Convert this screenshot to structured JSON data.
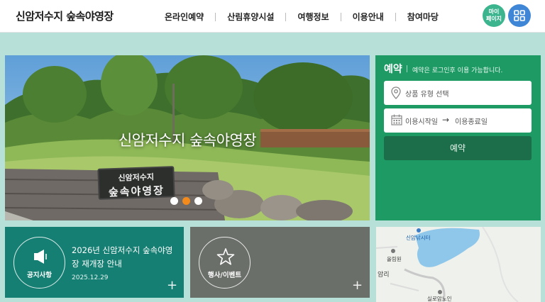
{
  "header": {
    "site_title": "신암저수지 숲속야영장",
    "nav": [
      "온라인예약",
      "산림휴양시설",
      "여행정보",
      "이용안내",
      "참여마당"
    ],
    "mypage_line1": "마이",
    "mypage_line2": "페이지"
  },
  "hero": {
    "title": "신암저수지 숲속야영장",
    "sign_line1": "신암저수지",
    "sign_line2": "숲속야영장",
    "slide_count": 3,
    "active_slide": 2
  },
  "reservation": {
    "title": "예약",
    "note": "예약은 로그인후 이용 가능합니다.",
    "type_placeholder": "상품 유형 선택",
    "start_placeholder": "이용시작일",
    "arrow": "→",
    "end_placeholder": "이용종료일",
    "button_label": "예약"
  },
  "notice": {
    "label": "공지사항",
    "title": "2026년 신암저수지 숲속야영장 재개장 안내",
    "date": "2025.12.29",
    "plus": "+"
  },
  "event": {
    "label": "행사/이벤트",
    "plus": "+"
  },
  "map": {
    "labels": [
      "신암낚시터",
      "올림원",
      "암리",
      "실로암노인"
    ]
  },
  "colors": {
    "reserve_bg": "#1e9a64",
    "notice_bg": "#167f73",
    "event_bg": "#6b6f6a",
    "page_bg": "#b6e0d8",
    "active_dot": "#f28a1c"
  }
}
